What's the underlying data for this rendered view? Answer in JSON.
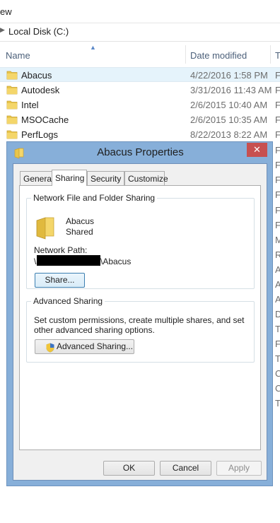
{
  "explorer": {
    "ribbon_partial": "ew",
    "address": "Local Disk (C:)",
    "columns": {
      "name": "Name",
      "date": "Date modified",
      "type": "T"
    },
    "rows": [
      {
        "name": "Abacus",
        "date": "4/22/2016 1:58 PM",
        "type": "F"
      },
      {
        "name": "Autodesk",
        "date": "3/31/2016 11:43 AM",
        "type": "F"
      },
      {
        "name": "Intel",
        "date": "2/6/2015 10:40 AM",
        "type": "F"
      },
      {
        "name": "MSOCache",
        "date": "2/6/2015 10:35 AM",
        "type": "F"
      },
      {
        "name": "PerfLogs",
        "date": "8/22/2013 8:22 AM",
        "type": "F"
      }
    ],
    "hidden_type_letters": [
      "F",
      "F",
      "F",
      "F",
      "F",
      "F",
      "M",
      "R",
      "A",
      "A",
      "A",
      "D",
      "T",
      "F",
      "T",
      "C",
      "C",
      "T"
    ]
  },
  "dialog": {
    "title": "Abacus Properties",
    "close_glyph": "✕",
    "tabs": [
      "General",
      "Sharing",
      "Security",
      "Customize"
    ],
    "active_tab": "Sharing",
    "network_group": {
      "legend": "Network File and Folder Sharing",
      "folder_name": "Abacus",
      "share_state": "Shared",
      "path_label": "Network Path:",
      "path_prefix": "\\",
      "path_suffix": "\\Abacus",
      "share_button": "Share..."
    },
    "advanced_group": {
      "legend": "Advanced Sharing",
      "description": "Set custom permissions, create multiple shares, and set other advanced sharing options.",
      "button": "Advanced Sharing..."
    },
    "buttons": {
      "ok": "OK",
      "cancel": "Cancel",
      "apply": "Apply"
    }
  },
  "colors": {
    "folder": "#e8c54b",
    "close": "#c75050",
    "frame": "#87afd9",
    "selection": "#e5f3fb"
  },
  "icons": [
    "folder-icon",
    "close-icon",
    "uac-shield-icon",
    "sort-ascending-icon",
    "chevron-right-icon"
  ]
}
